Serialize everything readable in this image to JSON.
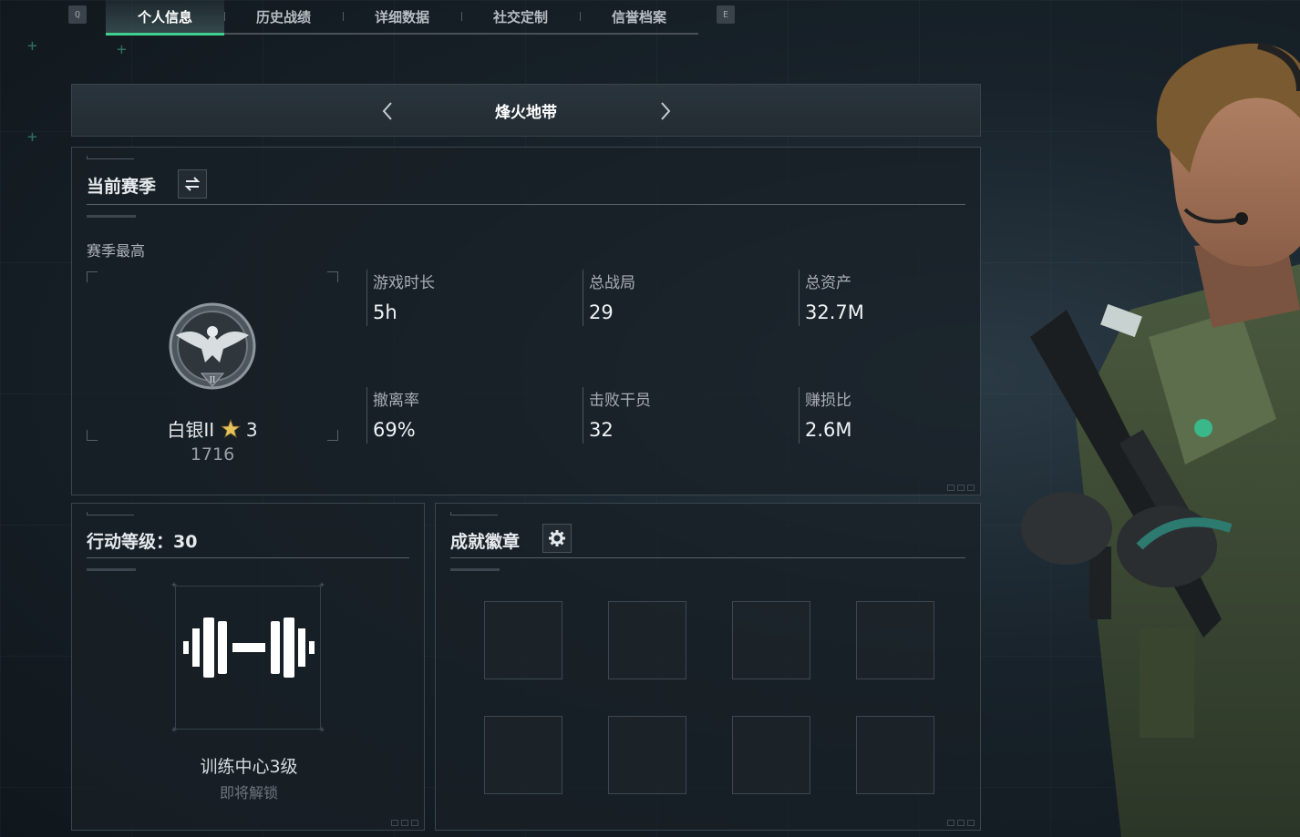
{
  "key_hints": {
    "left": "Q",
    "right": "E"
  },
  "tabs": [
    {
      "label": "个人信息",
      "active": true
    },
    {
      "label": "历史战绩",
      "active": false
    },
    {
      "label": "详细数据",
      "active": false
    },
    {
      "label": "社交定制",
      "active": false
    },
    {
      "label": "信誉档案",
      "active": false
    }
  ],
  "mode": {
    "title": "烽火地带",
    "prev_icon": "chevron-left-icon",
    "next_icon": "chevron-right-icon"
  },
  "season": {
    "title": "当前赛季",
    "switch_icon": "swap-icon",
    "best_label": "赛季最高",
    "rank": {
      "name": "白银II",
      "stars": "3",
      "score": "1716",
      "emblem_icon": "eagle-emblem-icon"
    },
    "stats": [
      {
        "label": "游戏时长",
        "value": "5h"
      },
      {
        "label": "总战局",
        "value": "29"
      },
      {
        "label": "总资产",
        "value": "32.7M"
      },
      {
        "label": "撤离率",
        "value": "69%"
      },
      {
        "label": "击败干员",
        "value": "32"
      },
      {
        "label": "赚损比",
        "value": "2.6M"
      }
    ]
  },
  "action_level": {
    "title": "行动等级：30",
    "unlock_name": "训练中心3级",
    "unlock_status": "即将解锁",
    "icon": "dumbbell-icon"
  },
  "achievements": {
    "title": "成就徽章",
    "settings_icon": "gear-icon",
    "slots": 8
  },
  "colors": {
    "accent": "#3fcf8e",
    "panel_bg": "#182026",
    "border": "#3a454d",
    "star": "#e6c25a"
  }
}
